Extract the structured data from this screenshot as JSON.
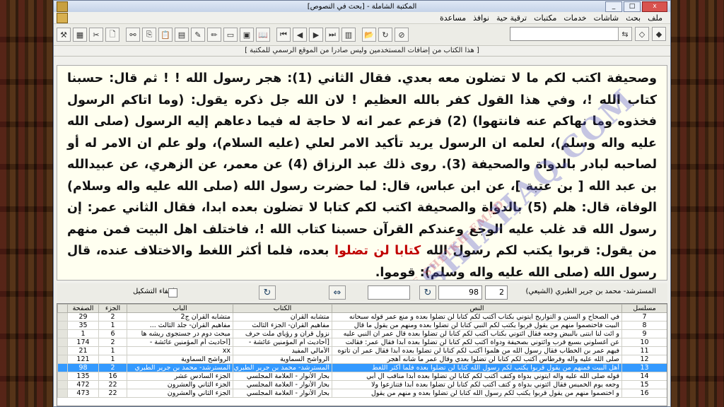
{
  "window": {
    "title": "المكتبة الشاملة - [بحث في النصوص]",
    "controls": [
      "_",
      "□",
      "x"
    ]
  },
  "menu": {
    "items": [
      "ملف",
      "بحث",
      "شاشات",
      "خدمات",
      "مكتبات",
      "ترقية حية",
      "نوافذ",
      "مساعدة"
    ],
    "doc_controls": [
      "_",
      "□",
      "x"
    ]
  },
  "toolbar": {
    "buttons": [
      {
        "name": "tools-icon",
        "glyph": "⚒"
      },
      {
        "name": "calc-icon",
        "glyph": "▦"
      },
      {
        "name": "cut-icon",
        "glyph": "✂"
      },
      {
        "name": "new-icon",
        "glyph": "🗋"
      },
      {
        "name": "binoculars-icon",
        "glyph": "⚯"
      },
      {
        "name": "copy-icon",
        "glyph": "⎘"
      },
      {
        "name": "paste-icon",
        "glyph": "📋"
      },
      {
        "name": "grid-icon",
        "glyph": "▤"
      },
      {
        "name": "edit-icon",
        "glyph": "✎"
      },
      {
        "name": "pen-icon",
        "glyph": "✏"
      },
      {
        "name": "clear-icon",
        "glyph": "▭"
      },
      {
        "name": "print-icon",
        "glyph": "▣"
      },
      {
        "name": "book-icon",
        "glyph": "📖"
      },
      {
        "name": "first-icon",
        "glyph": "⏮"
      },
      {
        "name": "prev-icon",
        "glyph": "◀"
      },
      {
        "name": "next-icon",
        "glyph": "▶"
      },
      {
        "name": "last-icon",
        "glyph": "⏭"
      },
      {
        "name": "library-icon",
        "glyph": "▥"
      },
      {
        "name": "open-icon",
        "glyph": "📂"
      },
      {
        "name": "refresh-icon",
        "glyph": "↻"
      },
      {
        "name": "stop-icon",
        "glyph": "⊘"
      }
    ],
    "right_buttons": [
      {
        "name": "compare-icon",
        "glyph": "⇆"
      },
      {
        "name": "tag-icon",
        "glyph": "◇"
      },
      {
        "name": "bookmark-icon",
        "glyph": "◆"
      }
    ]
  },
  "notice": "[ هذا الكتاب من إضافات المستخدمين وليس صادرا من الموقع الرسمي للمكتبة ]",
  "text": {
    "part1": "وصحيفة اكتب لكم ما لا تضلون معه بعدي. فقال الثاني (1): هجر رسول الله ! ! ثم قال: حسبنا كتاب الله !، وفي هذا القول كفر بالله العظيم ! لان الله جل ذكره يقول: (وما اتاكم الرسول فخذوه وما نهاكم عنه فانتهوا) (2) فزعم عمر انه لا حاجة له فيما دعاهم إليه الرسول (صلى الله عليه واله وسلم)، لعلمه ان الرسول يريد تأكيد الامر لعلي (عليه السلام)، ولو علم ان الامر له أو لصاحبه لبادر بالدواة والصحيفة (3). روى ذلك عبد الرزاق (4) عن معمر، عن الزهري، عن عبيدالله بن عبد الله [ بن عتبة ]، عن ابن عباس، قال: لما حضرت رسول الله (صلى الله عليه واله وسلام) الوفاة، قال: هلم (5) بالدواة والصحيفة اكتب لكم كتابا لا تضلون بعده ابدا، فقال الثاني عمر: إن رسول الله قد غلب عليه الوجع وعندكم القرآن حسبنا كتاب الله !، فاختلف اهل البيت فمن منهم من يقول: قربوا يكتب لكم رسول الله ",
    "red": "كتابا لن تضلوا",
    "part2": " بعده، فلما أكثر اللغط والاختلاف عنده، قال رسول الله (صلى الله عليه واله وسلم): قوموا.",
    "watermark": "WWW.SHIAHAQ.COM",
    "watermark2": "FARZANE SHEIKH-EMAD"
  },
  "nav": {
    "diacritics_label": "إخفاء التشكيل",
    "refresh_left": "↻",
    "back_arrows": "⇔",
    "page_value": "98",
    "part_value": "2",
    "refresh_right": "↻",
    "source_label": "المسترشد- محمد بن جرير الطبري (الشيعي)"
  },
  "grid": {
    "headers": [
      "مسلسل",
      "النص",
      "الكتاب",
      "الباب",
      "الجزء",
      "الصفحة"
    ],
    "rows": [
      [
        "7",
        "في الصحاح و السنن و التواريخ ايتوني بكتاب أكتب لكم كتابا لن تضلوا بعده و منع عمر قوله سبحانه",
        "متشابه القرآن",
        "متشابه القرآن ج2",
        "2",
        "29"
      ],
      [
        "8",
        "البيت فاختصموا منهم من يقول قربوا يكتب لكم النبي كتابا لن تضلوا بعده ومنهم من يقول ما قال",
        "مفاهيم القرآن- الجزء الثالث",
        "مفاهيم القرآن- جلد الثالث ...",
        "1",
        "35"
      ],
      [
        "9",
        "و ائت لنا ابتنى بالبيض وجعه فقال ائتوني بكتاب أكتب لكم كتابا لن تضلوا بعده قال عمر ان النبي عليه",
        "نزول قرآن و رؤياي ملت حرف",
        "مبحث دوم در جستجوی ریشه ها",
        "6",
        "1"
      ],
      [
        "10",
        "عن أغسلوني بسبع قرب وائتوني بصحيفة ودواة أكتب لكم كتابا لن تضلوا بعده أبدا فقال عمر: فقالت",
        "[أحاديث أم المؤمنين عائشة -",
        "[أحاديث أم المؤمنين عائشة -",
        "2",
        "174"
      ],
      [
        "11",
        "فيهم عمر بن الخطاب فقال رسول الله من هلموا أكتب لكم كتابا لن تضلوا بعده أبدا فقال عمر أن تأتوه",
        "الأمالي المفيد",
        "xx",
        "1",
        "21"
      ],
      [
        "12",
        "صلى الله عليه واله وقرطاس أكتب لكم كتابا لن تضلوا بعدي وقال عمر ما شأنه أهجر",
        "الرواشح السماوية",
        "الرواشح السماوية",
        "1",
        "121"
      ],
      [
        "13",
        "أهل البيت فمنهم من يقول قربوا يكتب لكم رسول الله كتابا لن تضلوا بعده فلما أكثر اللغط",
        "المسترشد- محمد بن جرير الطبري",
        "المسترشد- محمد بن جرير الطبري",
        "2",
        "98"
      ],
      [
        "14",
        "قوله صلى الله عليه واله ايتوني بدواة وكتف أكتب لكم كتابا لن تضلوا بعده أبدا مناقب آل أبي",
        "بحار الأنوار - العلامة المجلسي",
        "الجزء السادس عشر",
        "16",
        "135"
      ],
      [
        "15",
        "وجعه يوم الخميس فقال ائتوني بدواة و كتف أكتب لكم كتابا لن تضلوا بعده أبدا فتنازعوا ولا",
        "بحار الأنوار - العلامة المجلسي",
        "الجزء الثاني والعشرون",
        "22",
        "472"
      ],
      [
        "16",
        "و اختصموا منهم من يقول قربوا يكتب لكم رسول الله كتابا لن تضلوا بعده و منهم من يقول",
        "بحار الأنوار - العلامة المجلسي",
        "الجزء الثاني والعشرون",
        "22",
        "473"
      ]
    ],
    "selected_index": 6
  }
}
